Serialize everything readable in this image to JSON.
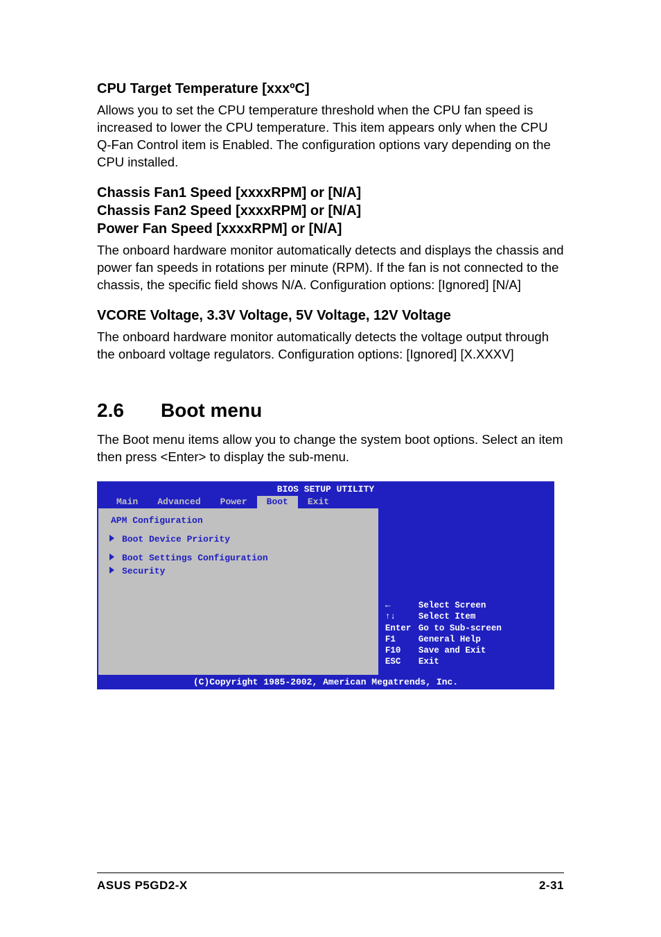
{
  "sections": {
    "cpu_target": {
      "heading": "CPU Target Temperature [xxxºC]",
      "body": "Allows you to set the CPU temperature threshold when the CPU fan speed is increased to lower the CPU temperature. This item appears only when the CPU Q-Fan Control item is Enabled. The configuration options vary depending on the CPU installed."
    },
    "fan_speed": {
      "heading1": "Chassis Fan1 Speed [xxxxRPM] or [N/A]",
      "heading2": "Chassis Fan2 Speed [xxxxRPM] or [N/A]",
      "heading3": "Power Fan Speed [xxxxRPM] or [N/A]",
      "body": "The onboard hardware monitor automatically detects and displays the chassis and power fan speeds in rotations per minute (RPM). If the fan is not connected to the chassis, the specific field shows N/A. Configuration options: [Ignored] [N/A]"
    },
    "voltage": {
      "heading": "VCORE Voltage, 3.3V Voltage, 5V Voltage, 12V Voltage",
      "body": "The onboard hardware monitor automatically detects the voltage output through the onboard voltage regulators. Configuration options: [Ignored] [X.XXXV]"
    },
    "boot_menu": {
      "number": "2.6",
      "title": "Boot menu",
      "body": "The Boot menu items allow you to change the system boot options. Select an item then press <Enter> to display the sub-menu."
    }
  },
  "bios": {
    "title": "BIOS SETUP UTILITY",
    "tabs": [
      "Main",
      "Advanced",
      "Power",
      "Boot",
      "Exit"
    ],
    "active_tab": "Boot",
    "left_title": "APM Configuration",
    "items": [
      "Boot Device Priority",
      "Boot Settings Configuration",
      "Security"
    ],
    "help": [
      {
        "key": "←",
        "text": "Select Screen"
      },
      {
        "key": "↑↓",
        "text": "Select Item"
      },
      {
        "key": "Enter",
        "text": "Go to Sub-screen"
      },
      {
        "key": "F1",
        "text": "General Help"
      },
      {
        "key": "F10",
        "text": "Save and Exit"
      },
      {
        "key": "ESC",
        "text": "Exit"
      }
    ],
    "copyright": "(C)Copyright 1985-2002, American Megatrends, Inc."
  },
  "footer": {
    "left": "ASUS P5GD2-X",
    "right": "2-31"
  }
}
